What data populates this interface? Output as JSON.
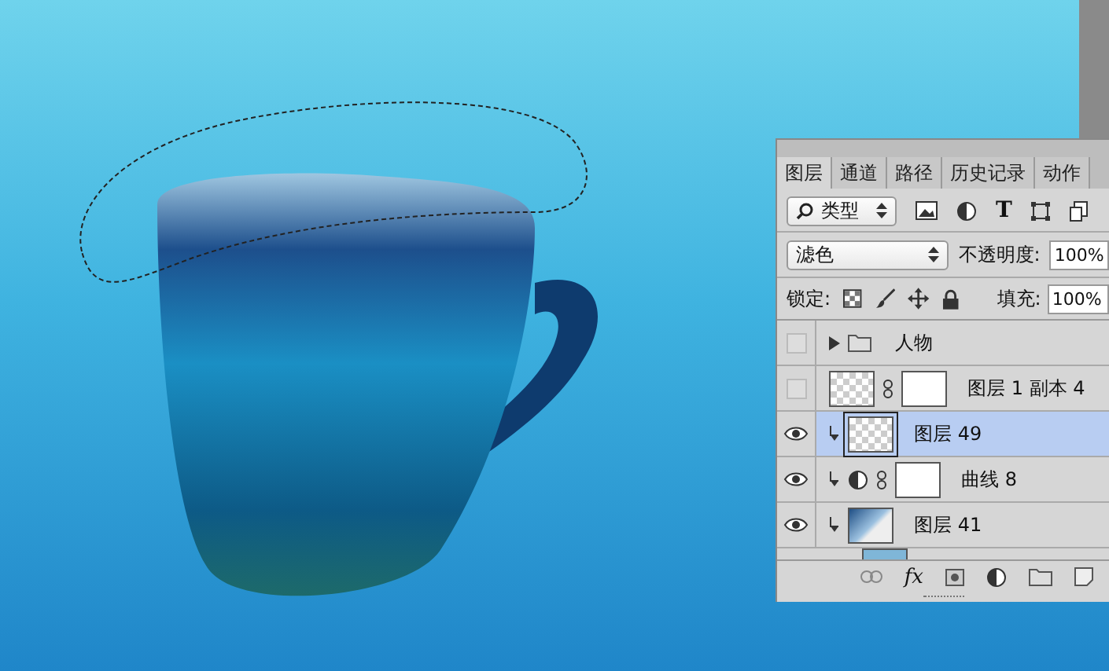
{
  "panel_tabs": [
    {
      "label": "图层",
      "selected": true
    },
    {
      "label": "通道",
      "selected": false
    },
    {
      "label": "路径",
      "selected": false
    },
    {
      "label": "历史记录",
      "selected": false
    },
    {
      "label": "动作",
      "selected": false
    }
  ],
  "filter": {
    "value": "类型",
    "type_filter_label": "T"
  },
  "blend_mode": {
    "value": "滤色"
  },
  "opacity": {
    "label": "不透明度:",
    "value": "100%"
  },
  "lock": {
    "label": "锁定:"
  },
  "fill": {
    "label": "填充:",
    "value": "100%"
  },
  "layers": [
    {
      "kind": "group",
      "name": "人物",
      "visible": false,
      "clipped": false,
      "selected": false
    },
    {
      "kind": "masked",
      "name": "图层 1 副本 4",
      "visible": false,
      "clipped": false,
      "selected": false
    },
    {
      "kind": "pixel",
      "name": "图层 49",
      "visible": true,
      "clipped": true,
      "selected": true
    },
    {
      "kind": "adjustment",
      "name": "曲线 8",
      "visible": true,
      "clipped": true,
      "selected": false
    },
    {
      "kind": "smart",
      "name": "图层 41",
      "visible": true,
      "clipped": true,
      "selected": false
    }
  ],
  "bottom_toolbar": {
    "effects_label": "fx"
  }
}
